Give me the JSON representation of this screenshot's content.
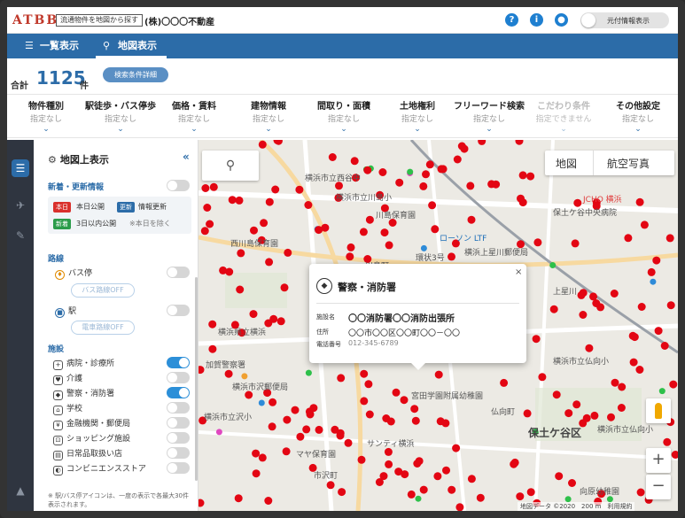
{
  "header": {
    "logo": "ATBB",
    "tagline": "流通物件を地図から探す",
    "company": "(株)〇〇〇不動産",
    "icons": [
      "help-icon",
      "info-icon",
      "user-icon"
    ],
    "original_info_toggle": "元付情報表示"
  },
  "nav": {
    "tabs": [
      {
        "label": "一覧表示",
        "icon": "list-icon",
        "active": false
      },
      {
        "label": "地図表示",
        "icon": "map-pin-icon",
        "active": true
      }
    ]
  },
  "summary": {
    "prefix": "合計",
    "count": "1125",
    "suffix": "件",
    "detail_button": "検索条件詳細"
  },
  "filters": [
    {
      "title": "物件種別",
      "sub": "指定なし",
      "enabled": true
    },
    {
      "title": "駅徒歩・バス停歩",
      "sub": "指定なし",
      "enabled": true
    },
    {
      "title": "価格・賃料",
      "sub": "指定なし",
      "enabled": true
    },
    {
      "title": "建物情報",
      "sub": "指定なし",
      "enabled": true
    },
    {
      "title": "間取り・面積",
      "sub": "指定なし",
      "enabled": true
    },
    {
      "title": "土地権利",
      "sub": "指定なし",
      "enabled": true
    },
    {
      "title": "フリーワード検索",
      "sub": "指定なし",
      "enabled": true
    },
    {
      "title": "こだわり条件",
      "sub": "指定できません",
      "enabled": false
    },
    {
      "title": "その他設定",
      "sub": "指定なし",
      "enabled": true
    }
  ],
  "panel": {
    "title": "地図上表示",
    "collapse": "«",
    "news": {
      "label": "新着・更新情報",
      "on": false,
      "tag_today": "本日",
      "today_text": "本日公開",
      "tag_update": "更新",
      "update_text": "情報更新",
      "tag_new": "新着",
      "new_text": "3日以内公開",
      "new_note": "※本日を除く"
    },
    "routes": {
      "label": "路線",
      "bus": {
        "label": "バス停",
        "on": false,
        "route_btn": "バス路線OFF"
      },
      "station": {
        "label": "駅",
        "on": false,
        "route_btn": "電車路線OFF"
      }
    },
    "facilities": {
      "label": "施設",
      "items": [
        {
          "label": "病院・診療所",
          "icon": "hospital-icon",
          "on": true
        },
        {
          "label": "介護",
          "icon": "care-icon",
          "on": false
        },
        {
          "label": "警察・消防署",
          "icon": "police-icon",
          "on": true
        },
        {
          "label": "学校",
          "icon": "school-icon",
          "on": false
        },
        {
          "label": "金融機関・郵便局",
          "icon": "bank-icon",
          "on": false
        },
        {
          "label": "ショッピング施設",
          "icon": "shopping-icon",
          "on": false
        },
        {
          "label": "日常品取扱い店",
          "icon": "store-icon",
          "on": false
        },
        {
          "label": "コンビニエンスストア",
          "icon": "convenience-icon",
          "on": false
        }
      ]
    },
    "note": "※ 駅/バス停アイコンは、一度の表示で各最大30件表示されます。"
  },
  "map": {
    "search_icon": "search-icon",
    "type_map": "地図",
    "type_aerial": "航空写真",
    "zoom_in": "+",
    "zoom_out": "−",
    "attribution": "地図データ ©2020　200 m　利用規約",
    "labels": [
      "横浜市立西谷中",
      "横浜市立川島小",
      "川島保育園",
      "西川島保育園",
      "ローソン LTF",
      "横浜上星川郵便局",
      "川島町",
      "環状3号",
      "横浜市立仏向小",
      "保土ケ谷区",
      "サンティ横浜",
      "横浜市沢郵便局",
      "加賀警察署",
      "横浜市立沢小",
      "上星川",
      "宮田学園附属幼稚園",
      "マヤ保育園",
      "市沢町",
      "仏向町",
      "横浜市立仏向小",
      "向原幼稚園",
      "JCHO 横浜",
      "保土ケ谷中央病院",
      "横浜県立横浜"
    ],
    "colors": {
      "property": "#e30613",
      "green": "#2ec04a",
      "blue": "#2e8bd8",
      "orange": "#f0a030",
      "pink": "#e048c0"
    }
  },
  "popup": {
    "icon": "shield-icon",
    "title": "警察・消防署",
    "name_label": "施設名",
    "name": "〇〇消防署〇〇消防出張所",
    "address_label": "住所",
    "address": "〇〇市〇〇区〇〇町〇〇－〇〇",
    "phone_label": "電話番号",
    "phone": "012-345-6789",
    "close": "×"
  }
}
